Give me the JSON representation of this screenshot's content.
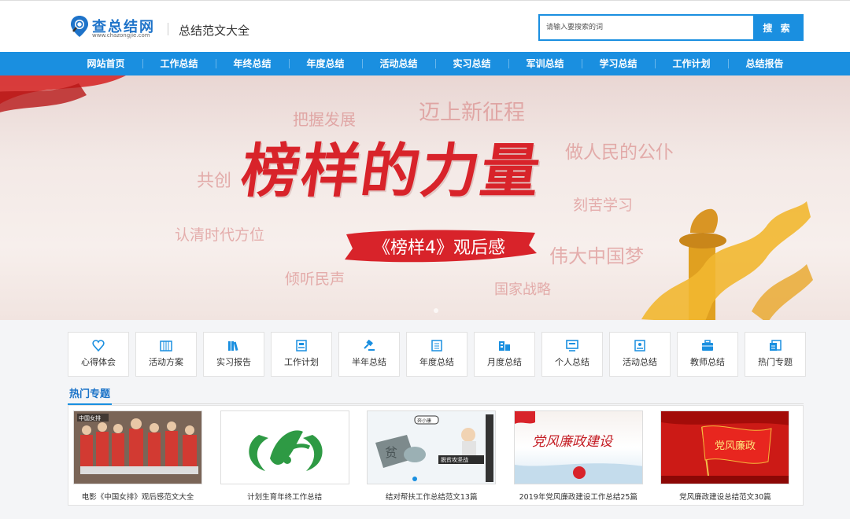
{
  "header": {
    "logo_text": "查总结网",
    "logo_url": "www.chazongjie.com",
    "site_title": "总结范文大全",
    "search_placeholder": "请输入要搜索的词",
    "search_button": "搜 索"
  },
  "nav": [
    "网站首页",
    "工作总结",
    "年终总结",
    "年度总结",
    "活动总结",
    "实习总结",
    "军训总结",
    "学习总结",
    "工作计划",
    "总结报告"
  ],
  "banner": {
    "headline": "榜样的力量",
    "subtitle": "《榜样4》观后感",
    "words": [
      "把握发展",
      "迈上新征程",
      "做人民的公仆",
      "共创",
      "刻苦学习",
      "认清时代方位",
      "伟大中国梦",
      "倾听民声",
      "国家战略"
    ]
  },
  "categories": [
    {
      "label": "心得体会",
      "icon": "heart-icon"
    },
    {
      "label": "活动方案",
      "icon": "calendar-icon"
    },
    {
      "label": "实习报告",
      "icon": "books-icon"
    },
    {
      "label": "工作计划",
      "icon": "clipboard-icon"
    },
    {
      "label": "半年总结",
      "icon": "gavel-icon"
    },
    {
      "label": "年度总结",
      "icon": "document-icon"
    },
    {
      "label": "月度总结",
      "icon": "building-icon"
    },
    {
      "label": "个人总结",
      "icon": "monitor-icon"
    },
    {
      "label": "活动总结",
      "icon": "report-icon"
    },
    {
      "label": "教师总结",
      "icon": "briefcase-icon"
    },
    {
      "label": "热门专题",
      "icon": "notes-icon"
    }
  ],
  "hot_topics": {
    "title": "热门专题",
    "cards": [
      {
        "caption": "电影《中国女排》观后感范文大全"
      },
      {
        "caption": "计划生育年终工作总结"
      },
      {
        "caption": "结对帮扶工作总结范文13篇"
      },
      {
        "caption": "2019年党风廉政建设工作总结25篇"
      },
      {
        "caption": "党风廉政建设总结范文30篇"
      }
    ],
    "card_texts": [
      "中国女排",
      "党风廉政建设",
      "党风廉政",
      "脱贫攻坚战",
      "奔小康"
    ]
  },
  "colors": {
    "brand_blue": "#1a8fe0",
    "banner_red": "#d8232a"
  }
}
